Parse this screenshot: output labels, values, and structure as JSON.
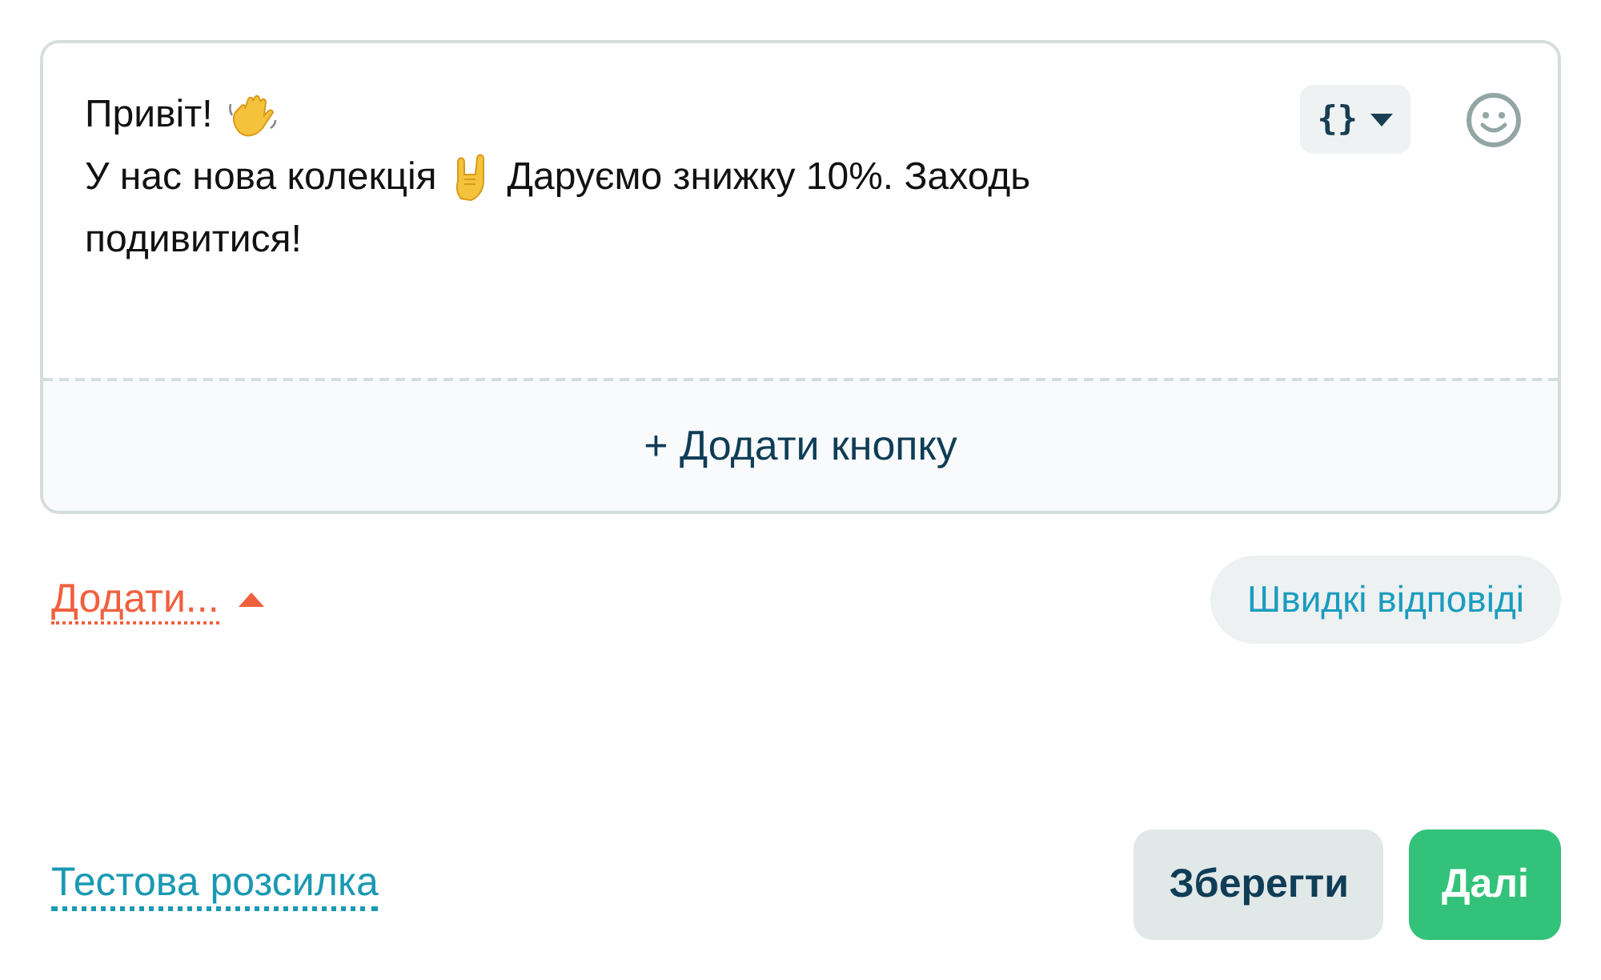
{
  "message": {
    "lines": [
      [
        {
          "kind": "text",
          "text": "Привіт!"
        },
        {
          "kind": "wave"
        }
      ],
      [
        {
          "kind": "text",
          "text": "У нас нова колекція"
        },
        {
          "kind": "horns"
        },
        {
          "kind": "text",
          "text": "Даруємо знижку 10%. Заходь"
        }
      ],
      [
        {
          "kind": "text",
          "text": "подивитися!"
        }
      ]
    ],
    "variables_button": "{}",
    "add_button": "+ Додати кнопку"
  },
  "add_menu": {
    "label": "Додати...",
    "expanded": true
  },
  "quick_replies": "Швидкі відповіді",
  "test_link": "Тестова розсилка",
  "buttons": [
    {
      "kind": "secondary",
      "label": "Зберегти"
    },
    {
      "kind": "primary",
      "label": "Далі"
    }
  ]
}
